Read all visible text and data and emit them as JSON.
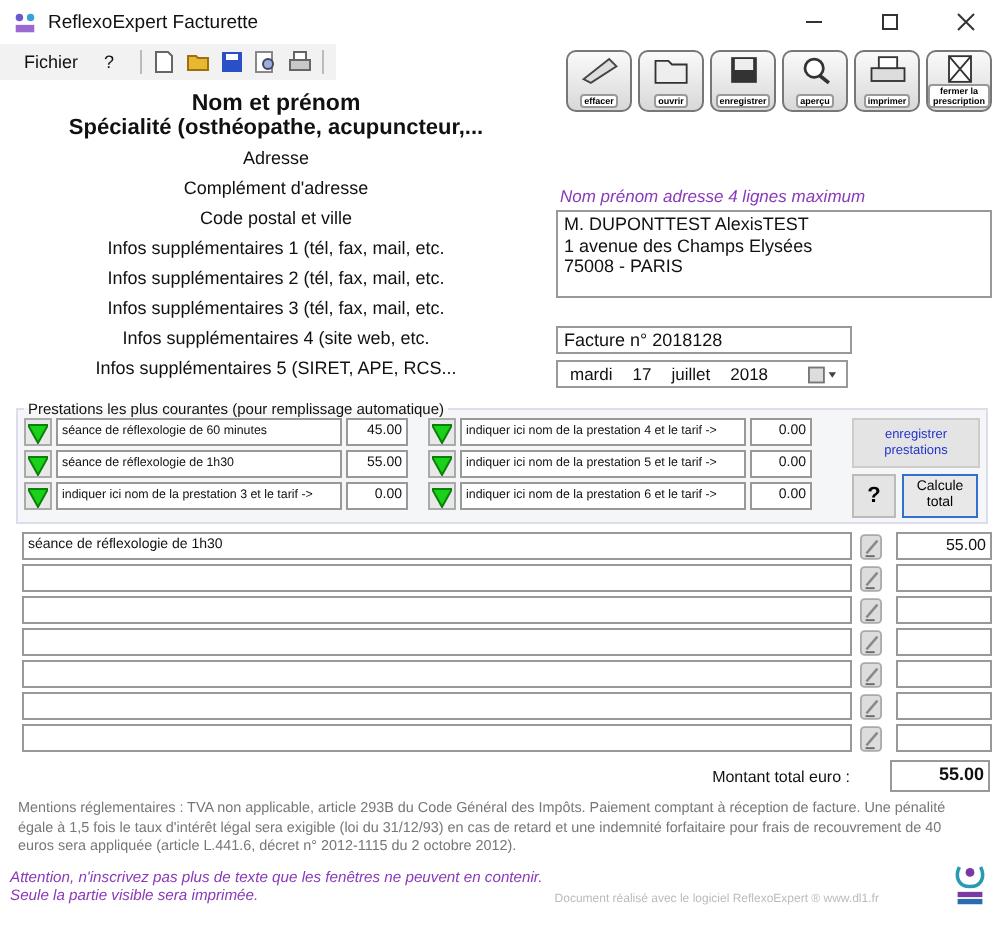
{
  "window": {
    "title": "ReflexoExpert Facturette"
  },
  "menu": [
    {
      "label": "Fichier"
    },
    {
      "label": "?"
    }
  ],
  "toolbar": [
    {
      "kind": "new"
    },
    {
      "kind": "open"
    },
    {
      "kind": "save"
    },
    {
      "kind": "preview"
    },
    {
      "kind": "print"
    }
  ],
  "big_buttons": [
    {
      "label": "effacer",
      "kind": "erase"
    },
    {
      "label": "ouvrir",
      "kind": "open"
    },
    {
      "label": "enregistrer",
      "kind": "save"
    },
    {
      "label": "aperçu",
      "kind": "preview"
    },
    {
      "label": "imprimer",
      "kind": "print"
    },
    {
      "label": "fermer la prescription",
      "kind": "close"
    }
  ],
  "practitioner": {
    "name": "Nom et prénom",
    "specialty": "Spécialité (osthéopathe, acupuncteur,...",
    "lines": [
      "Adresse",
      "Complément d'adresse",
      "Code postal et ville",
      "Infos supplémentaires 1 (tél, fax, mail, etc.",
      "Infos supplémentaires 2 (tél, fax, mail, etc.",
      "Infos supplémentaires 3 (tél, fax, mail, etc.",
      "Infos supplémentaires 4 (site web, etc.",
      "Infos supplémentaires 5 (SIRET, APE, RCS..."
    ]
  },
  "patient": {
    "hint": "Nom prénom adresse 4 lignes maximum",
    "address": [
      "M. DUPONTTEST AlexisTEST",
      "1 avenue des Champs Elysées",
      "75008 - PARIS"
    ]
  },
  "invoice_number": "Facture n° 2018128",
  "date": {
    "weekday": "mardi",
    "day": "17",
    "month": "juillet",
    "year": "2018"
  },
  "presets": {
    "title": "Prestations les plus courantes (pour remplissage automatique)",
    "items": [
      {
        "name": "séance de réflexologie de 60 minutes",
        "price": "45.00"
      },
      {
        "name": "séance de réflexologie de 1h30",
        "price": "55.00"
      },
      {
        "name": "indiquer ici nom de la prestation 3 et le tarif ->",
        "price": "0.00"
      },
      {
        "name": "indiquer ici nom de la prestation 4 et le tarif ->",
        "price": "0.00"
      },
      {
        "name": "indiquer ici nom de la prestation 5 et le tarif ->",
        "price": "0.00"
      },
      {
        "name": "indiquer ici nom de la prestation 6 et le tarif ->",
        "price": "0.00"
      }
    ],
    "save_button": "enregistrer prestations",
    "help_button": "?",
    "calc_button": "Calcule total"
  },
  "lines": [
    {
      "kind": "entry",
      "description": "séance de réflexologie de 1h30",
      "amount": "55.00"
    },
    {
      "kind": "blank"
    },
    {
      "kind": "blank"
    },
    {
      "kind": "blank"
    },
    {
      "kind": "blank"
    },
    {
      "kind": "blank"
    },
    {
      "kind": "blank"
    }
  ],
  "total": {
    "label": "Montant total euro :",
    "value": "55.00"
  },
  "legal": "Mentions réglementaires : TVA non applicable, article 293B du Code Général des Impôts. Paiement comptant à réception de facture. Une pénalité égale à 1,5 fois le taux d'intérêt légal sera exigible (loi du 31/12/93) en cas de retard et une indemnité forfaitaire pour frais de recouvrement de 40 euros sera appliquée (article L.441.6, décret n° 2012-1115 du 2 octobre 2012).",
  "warning": [
    "Attention, n'inscrivez pas plus de texte que les fenêtres ne peuvent en contenir.",
    "Seule la partie visible sera imprimée."
  ],
  "footer": "Document réalisé avec le logiciel ReflexoExpert ® www.dl1.fr"
}
